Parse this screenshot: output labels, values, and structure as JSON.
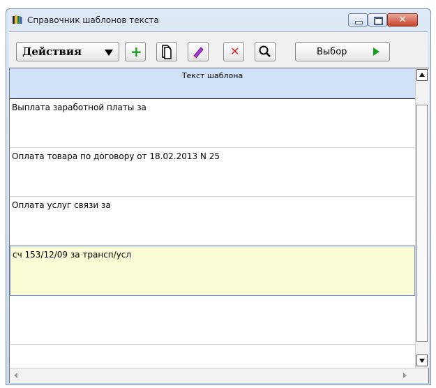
{
  "window": {
    "title": "Справочник шаблонов текста"
  },
  "toolbar": {
    "actions_label": "Действия",
    "select_label": "Выбор",
    "icons": [
      "plus-icon",
      "copy-icon",
      "pencil-icon",
      "delete-icon",
      "search-icon"
    ]
  },
  "grid": {
    "column_header": "Текст шаблона",
    "rows": [
      {
        "text": "Выплата заработной платы за"
      },
      {
        "text": "Оплата товара по договору от 18.02.2013 N 25"
      },
      {
        "text": "Оплата услуг связи за"
      },
      {
        "text": "сч 153/12/09 за трансп/усл",
        "selected": true
      }
    ]
  },
  "colors": {
    "header_bg": "#cfe2f7",
    "selected_row_bg": "#fbfcd5",
    "add_green": "#14a01e",
    "delete_red": "#e02222",
    "close_button": "#c7432c"
  }
}
